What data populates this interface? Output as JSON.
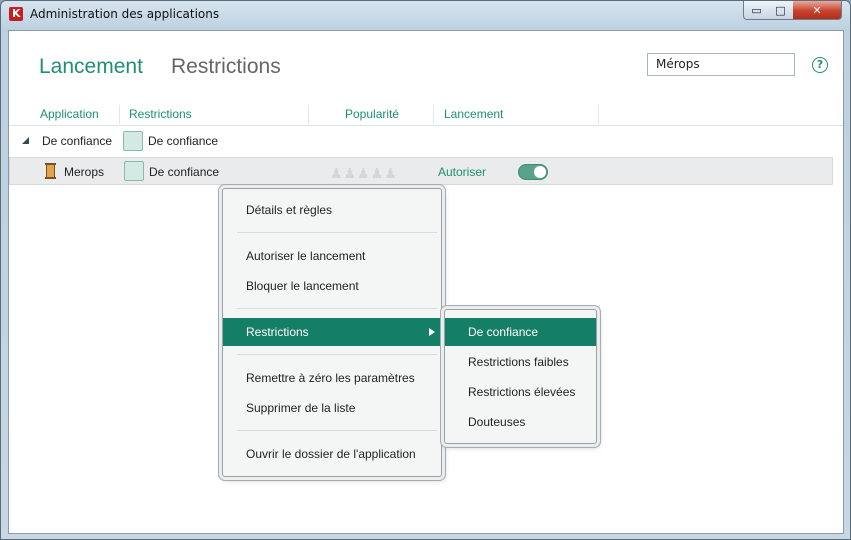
{
  "window": {
    "title": "Administration des applications",
    "controls": {
      "minimize": "▭",
      "maximize": "□",
      "close": "✕"
    }
  },
  "tabs": [
    {
      "label": "Lancement",
      "active": true
    },
    {
      "label": "Restrictions",
      "active": false
    }
  ],
  "search": {
    "value": "Mérops",
    "placeholder": ""
  },
  "help_icon": "?",
  "columns": [
    "Application",
    "Restrictions",
    "Popularité",
    "Lancement"
  ],
  "rows": [
    {
      "type": "group",
      "name": "De confiance",
      "restriction": "De confiance"
    },
    {
      "type": "app",
      "name": "Merops",
      "restriction": "De confiance",
      "popularity": 0,
      "launch": "Autoriser",
      "toggle_on": true
    }
  ],
  "context_menu": {
    "items": [
      {
        "label": "Détails et règles"
      },
      {
        "label": "Autoriser le lancement"
      },
      {
        "label": "Bloquer le lancement"
      },
      {
        "label": "Restrictions",
        "selected": true,
        "submenu": true
      },
      {
        "label": "Remettre à zéro les paramètres"
      },
      {
        "label": "Supprimer de la liste"
      },
      {
        "label": "Ouvrir le dossier de l'application"
      }
    ]
  },
  "submenu": {
    "items": [
      {
        "label": "De confiance",
        "selected": true
      },
      {
        "label": "Restrictions faibles"
      },
      {
        "label": "Restrictions élevées"
      },
      {
        "label": "Douteuses"
      }
    ]
  },
  "colors": {
    "accent": "#1e8f72",
    "menu_selected": "#157e66",
    "close_button": "#c7432e"
  }
}
